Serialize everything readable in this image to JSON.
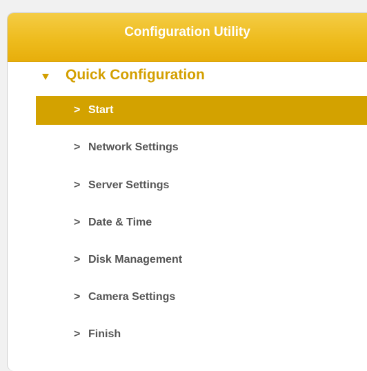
{
  "header": {
    "title": "Configuration Utility"
  },
  "section": {
    "title": "Quick Configuration",
    "expanded": true,
    "indicator_icon": "triangle-down-icon"
  },
  "menu": {
    "caret": ">",
    "active_index": 0,
    "items": [
      {
        "label": "Start"
      },
      {
        "label": "Network Settings"
      },
      {
        "label": "Server Settings"
      },
      {
        "label": "Date & Time"
      },
      {
        "label": "Disk Management"
      },
      {
        "label": "Camera Settings"
      },
      {
        "label": "Finish"
      }
    ]
  },
  "colors": {
    "header_gradient_top": "#f4cc45",
    "header_gradient_bottom": "#e7ae0b",
    "section_title": "#d39f00",
    "active_item_bg": "#d3a200",
    "item_text": "#555555"
  }
}
